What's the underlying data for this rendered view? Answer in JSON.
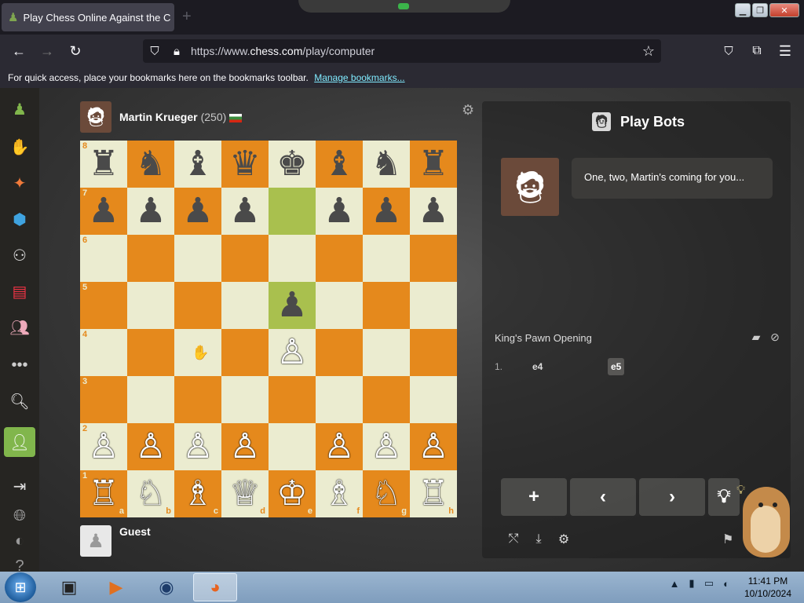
{
  "browser": {
    "tab_title": "Play Chess Online Against the C",
    "url_prefix": "https://www.",
    "url_domain": "chess.com",
    "url_path": "/play/computer",
    "bookmark_hint": "For quick access, place your bookmarks here on the bookmarks toolbar.",
    "manage_bookmarks": "Manage bookmarks..."
  },
  "opponent": {
    "name": "Martin Krueger",
    "rating": "(250)"
  },
  "player": {
    "name": "Guest"
  },
  "board": {
    "ranks": [
      "8",
      "7",
      "6",
      "5",
      "4",
      "3",
      "2",
      "1"
    ],
    "files": [
      "a",
      "b",
      "c",
      "d",
      "e",
      "f",
      "g",
      "h"
    ],
    "rows": [
      [
        "♜",
        "♞",
        "♝",
        "♛",
        "♚",
        "♝",
        "♞",
        "♜"
      ],
      [
        "♟",
        "♟",
        "♟",
        "♟",
        "",
        "♟",
        "♟",
        "♟"
      ],
      [
        "",
        "",
        "",
        "",
        "",
        "",
        "",
        ""
      ],
      [
        "",
        "",
        "",
        "",
        "♟",
        "",
        "",
        ""
      ],
      [
        "",
        "",
        "",
        "",
        "♙",
        "",
        "",
        ""
      ],
      [
        "",
        "",
        "",
        "",
        "",
        "",
        "",
        ""
      ],
      [
        "♙",
        "♙",
        "♙",
        "♙",
        "",
        "♙",
        "♙",
        "♙"
      ],
      [
        "♖",
        "♘",
        "♗",
        "♕",
        "♔",
        "♗",
        "♘",
        "♖"
      ]
    ],
    "highlighted": [
      [
        1,
        4
      ],
      [
        3,
        4
      ]
    ],
    "light_color": "#ebecd0",
    "dark_color": "#e5891c"
  },
  "panel": {
    "title": "Play Bots",
    "bot_message": "One, two, Martin's coming for you...",
    "opening": "King's Pawn Opening",
    "moves": [
      {
        "number": "1.",
        "white": "e4",
        "black": "e5"
      }
    ]
  },
  "taskbar": {
    "time": "11:41 PM",
    "date": "10/10/2024"
  }
}
